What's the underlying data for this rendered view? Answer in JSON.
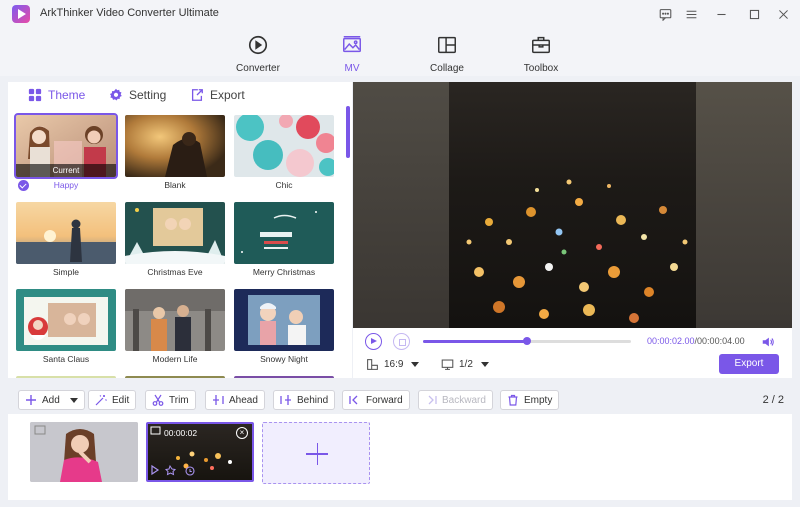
{
  "app": {
    "title": "ArkThinker Video Converter Ultimate"
  },
  "nav": [
    {
      "label": "Converter",
      "icon": "converter-icon"
    },
    {
      "label": "MV",
      "icon": "mv-icon",
      "active": true
    },
    {
      "label": "Collage",
      "icon": "collage-icon"
    },
    {
      "label": "Toolbox",
      "icon": "toolbox-icon"
    }
  ],
  "tabs": [
    {
      "label": "Theme",
      "icon": "theme-icon",
      "active": true
    },
    {
      "label": "Setting",
      "icon": "gear-icon"
    },
    {
      "label": "Export",
      "icon": "export-icon"
    }
  ],
  "themes": [
    {
      "name": "Happy",
      "current_label": "Current",
      "selected": true
    },
    {
      "name": "Blank"
    },
    {
      "name": "Chic"
    },
    {
      "name": "Simple"
    },
    {
      "name": "Christmas Eve"
    },
    {
      "name": "Merry Christmas"
    },
    {
      "name": "Santa Claus"
    },
    {
      "name": "Modern Life"
    },
    {
      "name": "Snowy Night"
    }
  ],
  "player": {
    "current_time": "00:00:02.00",
    "total_time": "/00:00:04.00",
    "progress": 0.5,
    "aspect_ratio": "16:9",
    "screen_ratio": "1/2",
    "export_label": "Export"
  },
  "toolbar": {
    "add": "Add",
    "edit": "Edit",
    "trim": "Trim",
    "ahead": "Ahead",
    "behind": "Behind",
    "forward": "Forward",
    "backward": "Backward",
    "empty": "Empty",
    "page_current": "2",
    "page_sep": " / ",
    "page_total": "2"
  },
  "timeline": {
    "clip2_time": "00:00:02"
  },
  "colors": {
    "accent": "#7a57e8"
  }
}
